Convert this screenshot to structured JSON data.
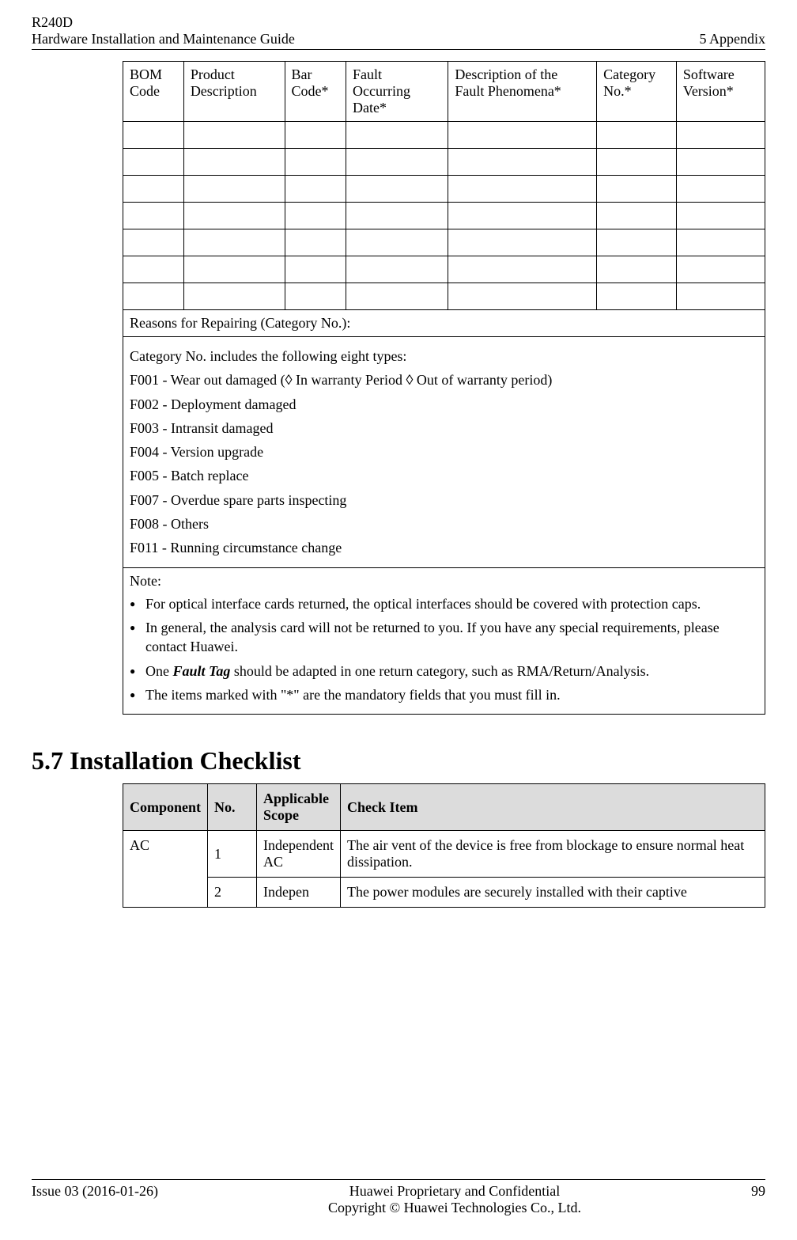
{
  "header": {
    "doc_code": "R240D",
    "doc_title": "Hardware Installation and Maintenance Guide",
    "chapter": "5 Appendix"
  },
  "fault_table": {
    "headers": [
      "BOM Code",
      "Product Description",
      "Bar Code*",
      "Fault Occurring Date*",
      "Description of the Fault Phenomena*",
      "Category No.*",
      "Software Version*"
    ],
    "reasons_heading": "Reasons for Repairing (Category No.):",
    "categories_intro": "Category No. includes the following eight types:",
    "categories": [
      "F001 - Wear out damaged (◊ In warranty Period ◊ Out of warranty period)",
      "F002 - Deployment damaged",
      "F003 - Intransit damaged",
      "F004 - Version upgrade",
      "F005 - Batch replace",
      "F007 - Overdue spare parts inspecting",
      "F008 - Others",
      "F011 - Running circumstance change"
    ],
    "note_label": "Note:",
    "notes": [
      {
        "pre": "For optical interface cards returned, the optical interfaces should be covered with protection caps."
      },
      {
        "pre": "In general, the analysis card will not be returned to you. If you have any special requirements, please contact Huawei."
      },
      {
        "pre": "One ",
        "bold": "Fault Tag",
        "post": " should be adapted in one return category, such as RMA/Return/Analysis."
      },
      {
        "pre": "The items marked with \"*\" are the mandatory fields that you must fill in."
      }
    ]
  },
  "section": {
    "title": "5.7 Installation Checklist"
  },
  "check_table": {
    "headers": [
      "Component",
      "No.",
      "Applicable Scope",
      "Check Item"
    ],
    "rows": [
      {
        "component": "AC",
        "no": "1",
        "scope": "Independent AC",
        "item": "The air vent of the device is free from blockage to ensure normal heat dissipation."
      },
      {
        "no": "2",
        "scope": "Indepen",
        "item": "The power modules are securely installed with their captive"
      }
    ]
  },
  "footer": {
    "issue": "Issue 03 (2016-01-26)",
    "line1": "Huawei Proprietary and Confidential",
    "line2": "Copyright © Huawei Technologies Co., Ltd.",
    "page_no": "99"
  }
}
